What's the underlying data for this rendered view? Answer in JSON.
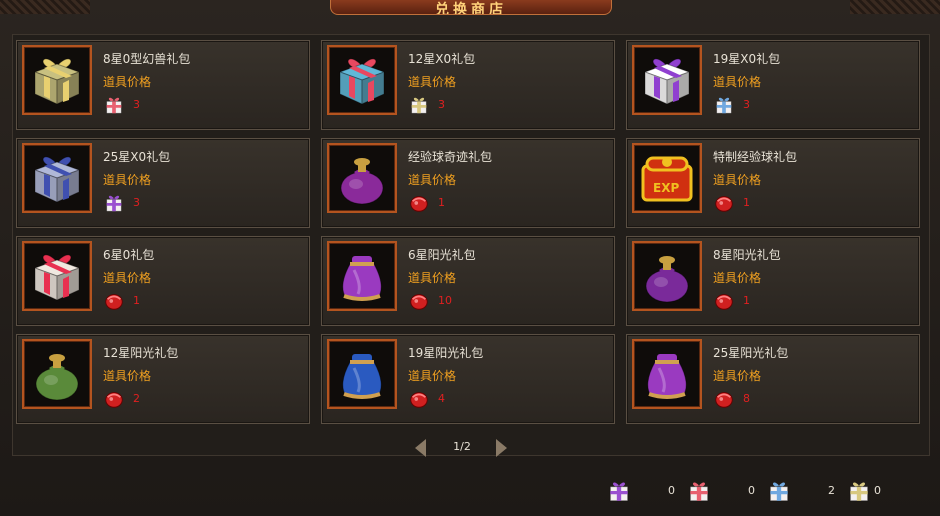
{
  "window": {
    "title": "兑换商店"
  },
  "items": [
    {
      "name": "8星0型幻兽礼包",
      "price_label": "道具价格",
      "cost": "3",
      "gift_color": "#c8c080",
      "ribbon": "#e8d070",
      "cost_icon": "gift-pink-icon",
      "cost_color": "#e86070",
      "type": "gift"
    },
    {
      "name": "12星X0礼包",
      "price_label": "道具价格",
      "cost": "3",
      "gift_color": "#60b8d8",
      "ribbon": "#e84860",
      "cost_icon": "gift-gold-icon",
      "cost_color": "#d8c880",
      "type": "gift"
    },
    {
      "name": "19星X0礼包",
      "price_label": "道具价格",
      "cost": "3",
      "gift_color": "#ffffff",
      "ribbon": "#9040d0",
      "cost_icon": "gift-blue-pink-icon",
      "cost_color": "#70a8e0",
      "type": "gift"
    },
    {
      "name": "25星X0礼包",
      "price_label": "道具价格",
      "cost": "3",
      "gift_color": "#b0b8d8",
      "ribbon": "#4050b0",
      "cost_icon": "gift-purple-icon",
      "cost_color": "#9a50d0",
      "type": "gift"
    },
    {
      "name": "经验球奇迹礼包",
      "price_label": "道具价格",
      "cost": "1",
      "gift_color": "#8a2a9a",
      "ribbon": "#c8a040",
      "cost_icon": "red-gem-icon",
      "cost_color": "#d02020",
      "type": "bag"
    },
    {
      "name": "特制经验球礼包",
      "price_label": "道具价格",
      "cost": "1",
      "gift_color": "#d03010",
      "ribbon": "#f0c020",
      "cost_icon": "red-gem-icon",
      "cost_color": "#d02020",
      "type": "chest"
    },
    {
      "name": "6星0礼包",
      "price_label": "道具价格",
      "cost": "1",
      "gift_color": "#f0e8e0",
      "ribbon": "#e83050",
      "cost_icon": "red-gem-icon",
      "cost_color": "#d02020",
      "type": "gift"
    },
    {
      "name": "6星阳光礼包",
      "price_label": "道具价格",
      "cost": "10",
      "gift_color": "#9a3ac0",
      "ribbon": "#d0a050",
      "cost_icon": "red-gem-icon",
      "cost_color": "#d02020",
      "type": "sack"
    },
    {
      "name": "8星阳光礼包",
      "price_label": "道具价格",
      "cost": "1",
      "gift_color": "#7a2a9a",
      "ribbon": "#c8a040",
      "cost_icon": "red-gem-icon",
      "cost_color": "#d02020",
      "type": "bag"
    },
    {
      "name": "12星阳光礼包",
      "price_label": "道具价格",
      "cost": "2",
      "gift_color": "#5a8a3a",
      "ribbon": "#c8a040",
      "cost_icon": "red-gem-icon",
      "cost_color": "#d02020",
      "type": "bag"
    },
    {
      "name": "19星阳光礼包",
      "price_label": "道具价格",
      "cost": "4",
      "gift_color": "#2a5ac0",
      "ribbon": "#d0a050",
      "cost_icon": "red-gem-icon",
      "cost_color": "#d02020",
      "type": "sack"
    },
    {
      "name": "25星阳光礼包",
      "price_label": "道具价格",
      "cost": "8",
      "gift_color": "#9a3ac0",
      "ribbon": "#d0a050",
      "cost_icon": "red-gem-icon",
      "cost_color": "#d02020",
      "type": "sack"
    }
  ],
  "pager": {
    "text": "1/2"
  },
  "resources": [
    {
      "icon": "gift-purple-icon",
      "color": "#9a50d0",
      "value": "0"
    },
    {
      "icon": "gift-pink-icon",
      "color": "#e86070",
      "value": "0"
    },
    {
      "icon": "gift-blue-pink-icon",
      "color": "#70a8e0",
      "value": "2"
    },
    {
      "icon": "gift-gold-icon",
      "color": "#d8c880",
      "value": "0"
    }
  ]
}
